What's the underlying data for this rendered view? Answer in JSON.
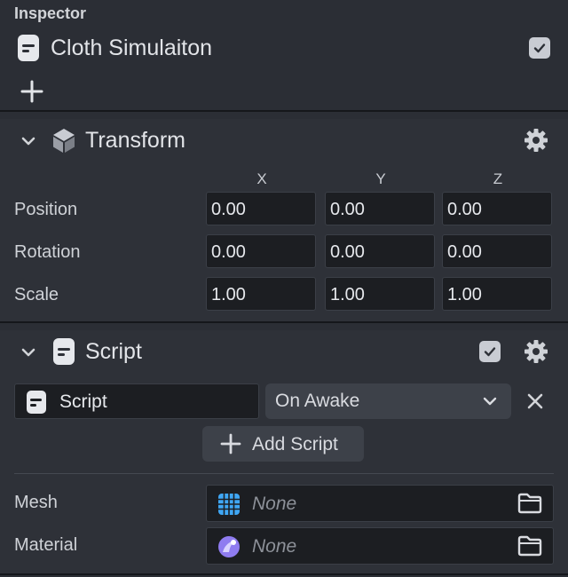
{
  "panel_title": "Inspector",
  "object": {
    "name": "Cloth Simulaiton",
    "enabled": true,
    "icon": "script-doc-icon"
  },
  "add_component_icon": "plus-icon",
  "transform": {
    "title": "Transform",
    "icon": "cube-icon",
    "axes": [
      "X",
      "Y",
      "Z"
    ],
    "rows": [
      {
        "label": "Position",
        "values": [
          "0.00",
          "0.00",
          "0.00"
        ]
      },
      {
        "label": "Rotation",
        "values": [
          "0.00",
          "0.00",
          "0.00"
        ]
      },
      {
        "label": "Scale",
        "values": [
          "1.00",
          "1.00",
          "1.00"
        ]
      }
    ]
  },
  "script": {
    "title": "Script",
    "enabled": true,
    "field_value": "Script",
    "event_selected": "On Awake",
    "add_button_label": "Add Script"
  },
  "assets": [
    {
      "label": "Mesh",
      "value": "None",
      "icon": "mesh-grid-icon",
      "icon_color": "#3fa7f5"
    },
    {
      "label": "Material",
      "value": "None",
      "icon": "material-icon",
      "icon_color": "#8f7cf0"
    }
  ],
  "colors": {
    "background": "#2b2e35",
    "field": "#1c1e22",
    "button": "#3d4149",
    "checkbox": "#c9ccd3"
  }
}
